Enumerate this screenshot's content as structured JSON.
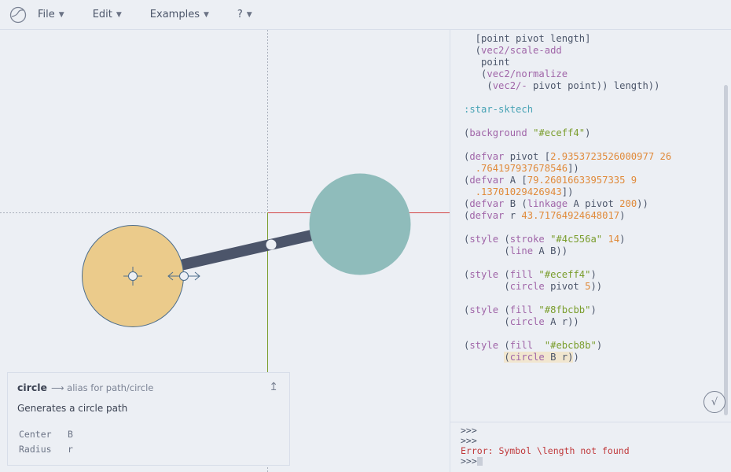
{
  "menu": {
    "items": [
      {
        "label": "File"
      },
      {
        "label": "Edit"
      },
      {
        "label": "Examples"
      },
      {
        "label": "?"
      }
    ]
  },
  "info": {
    "name": "circle",
    "alias": "⟶ alias for path/circle",
    "description": "Generates a circle path",
    "params": [
      {
        "name": "Center",
        "value": "B"
      },
      {
        "name": "Radius",
        "value": "r"
      }
    ],
    "pin_icon": "↥"
  },
  "editor": {
    "lines": [
      [
        {
          "t": "  [point pivot length]",
          "c": "p"
        }
      ],
      [
        {
          "t": "  (",
          "c": "p"
        },
        {
          "t": "vec2/scale-add",
          "c": "fn"
        }
      ],
      [
        {
          "t": "   point",
          "c": "p"
        }
      ],
      [
        {
          "t": "   (",
          "c": "p"
        },
        {
          "t": "vec2/normalize",
          "c": "fn"
        }
      ],
      [
        {
          "t": "    (",
          "c": "p"
        },
        {
          "t": "vec2/-",
          "c": "fn"
        },
        {
          "t": " pivot point)) length))",
          "c": "p"
        }
      ],
      [
        {
          "t": "",
          "c": "p"
        }
      ],
      [
        {
          "t": ":star-sktech",
          "c": "kw"
        }
      ],
      [
        {
          "t": "",
          "c": "p"
        }
      ],
      [
        {
          "t": "(",
          "c": "p"
        },
        {
          "t": "background",
          "c": "fn"
        },
        {
          "t": " ",
          "c": "p"
        },
        {
          "t": "\"#eceff4\"",
          "c": "str"
        },
        {
          "t": ")",
          "c": "p"
        }
      ],
      [
        {
          "t": "",
          "c": "p"
        }
      ],
      [
        {
          "t": "(",
          "c": "p"
        },
        {
          "t": "defvar",
          "c": "fn"
        },
        {
          "t": " pivot [",
          "c": "p"
        },
        {
          "t": "2.9353723526000977 26",
          "c": "num"
        }
      ],
      [
        {
          "t": "  ",
          "c": "p"
        },
        {
          "t": ".764197937678546",
          "c": "num"
        },
        {
          "t": "])",
          "c": "p"
        }
      ],
      [
        {
          "t": "(",
          "c": "p"
        },
        {
          "t": "defvar",
          "c": "fn"
        },
        {
          "t": " A [",
          "c": "p"
        },
        {
          "t": "79.26016633957335 9",
          "c": "num"
        }
      ],
      [
        {
          "t": "  ",
          "c": "p"
        },
        {
          "t": ".13701029426943",
          "c": "num"
        },
        {
          "t": "])",
          "c": "p"
        }
      ],
      [
        {
          "t": "(",
          "c": "p"
        },
        {
          "t": "defvar",
          "c": "fn"
        },
        {
          "t": " B (",
          "c": "p"
        },
        {
          "t": "linkage",
          "c": "fn"
        },
        {
          "t": " A pivot ",
          "c": "p"
        },
        {
          "t": "200",
          "c": "num"
        },
        {
          "t": "))",
          "c": "p"
        }
      ],
      [
        {
          "t": "(",
          "c": "p"
        },
        {
          "t": "defvar",
          "c": "fn"
        },
        {
          "t": " r ",
          "c": "p"
        },
        {
          "t": "43.71764924648017",
          "c": "num"
        },
        {
          "t": ")",
          "c": "p"
        }
      ],
      [
        {
          "t": "",
          "c": "p"
        }
      ],
      [
        {
          "t": "(",
          "c": "p"
        },
        {
          "t": "style",
          "c": "fn"
        },
        {
          "t": " (",
          "c": "p"
        },
        {
          "t": "stroke",
          "c": "fn"
        },
        {
          "t": " ",
          "c": "p"
        },
        {
          "t": "\"#4c556a\"",
          "c": "str"
        },
        {
          "t": " ",
          "c": "p"
        },
        {
          "t": "14",
          "c": "num"
        },
        {
          "t": ")",
          "c": "p"
        }
      ],
      [
        {
          "t": "       (",
          "c": "p"
        },
        {
          "t": "line",
          "c": "fn"
        },
        {
          "t": " A B))",
          "c": "p"
        }
      ],
      [
        {
          "t": "",
          "c": "p"
        }
      ],
      [
        {
          "t": "(",
          "c": "p"
        },
        {
          "t": "style",
          "c": "fn"
        },
        {
          "t": " (",
          "c": "p"
        },
        {
          "t": "fill",
          "c": "fn"
        },
        {
          "t": " ",
          "c": "p"
        },
        {
          "t": "\"#eceff4\"",
          "c": "str"
        },
        {
          "t": ")",
          "c": "p"
        }
      ],
      [
        {
          "t": "       (",
          "c": "p"
        },
        {
          "t": "circle",
          "c": "fn"
        },
        {
          "t": " pivot ",
          "c": "p"
        },
        {
          "t": "5",
          "c": "num"
        },
        {
          "t": "))",
          "c": "p"
        }
      ],
      [
        {
          "t": "",
          "c": "p"
        }
      ],
      [
        {
          "t": "(",
          "c": "p"
        },
        {
          "t": "style",
          "c": "fn"
        },
        {
          "t": " (",
          "c": "p"
        },
        {
          "t": "fill",
          "c": "fn"
        },
        {
          "t": " ",
          "c": "p"
        },
        {
          "t": "\"#8fbcbb\"",
          "c": "str"
        },
        {
          "t": ")",
          "c": "p"
        }
      ],
      [
        {
          "t": "       (",
          "c": "p"
        },
        {
          "t": "circle",
          "c": "fn"
        },
        {
          "t": " A r))",
          "c": "p"
        }
      ],
      [
        {
          "t": "",
          "c": "p"
        }
      ],
      [
        {
          "t": "(",
          "c": "p"
        },
        {
          "t": "style",
          "c": "fn"
        },
        {
          "t": " (",
          "c": "p"
        },
        {
          "t": "fill",
          "c": "fn"
        },
        {
          "t": "  ",
          "c": "p"
        },
        {
          "t": "\"#ebcb8b\"",
          "c": "str"
        },
        {
          "t": ")",
          "c": "p"
        }
      ],
      [
        {
          "t": "       ",
          "c": "p"
        },
        {
          "t": "(",
          "c": "p hl"
        },
        {
          "t": "circle",
          "c": "fn hl"
        },
        {
          "t": " B r)",
          "c": "p hl"
        },
        {
          "t": ")",
          "c": "p"
        }
      ]
    ],
    "eval_icon": "√"
  },
  "console": {
    "lines": [
      {
        "text": ">>>",
        "type": "prompt"
      },
      {
        "text": ">>>",
        "type": "prompt"
      },
      {
        "text": "Error: Symbol \\length not found",
        "type": "error"
      },
      {
        "text": ">>>",
        "type": "prompt-active"
      }
    ]
  },
  "colors": {
    "background": "#eceff4",
    "stroke": "#4c556a",
    "circle_a": "#8fbcbb",
    "circle_b": "#ebcb8b",
    "axis_x": "#d34545",
    "axis_y": "#7a9d2c"
  }
}
